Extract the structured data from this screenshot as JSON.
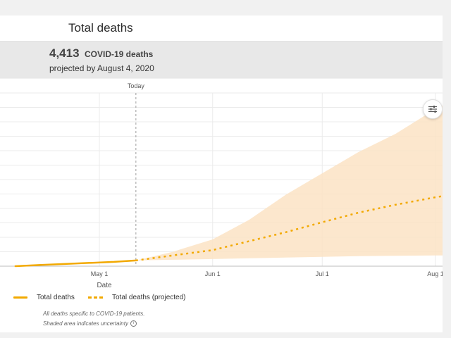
{
  "header": {
    "title": "Total deaths"
  },
  "summary": {
    "count": "4,413",
    "count_label": "COVID-19 deaths",
    "projection_text": "projected by August 4, 2020"
  },
  "chart_data": {
    "type": "line",
    "xlabel": "Date",
    "ylabel": "",
    "x_tick_labels": [
      "May 1",
      "Jun 1",
      "Jul 1",
      "Aug 1"
    ],
    "today_label": "Today",
    "grid": true,
    "legend_placement": "bottom",
    "series": [
      {
        "name": "Total deaths",
        "style": "solid",
        "color": "#f2a900",
        "x": [
          "Apr 8",
          "Apr 15",
          "Apr 22",
          "Apr 29",
          "May 5",
          "May 11"
        ],
        "y": [
          0.0,
          0.035,
          0.065,
          0.095,
          0.12,
          0.16
        ]
      },
      {
        "name": "Total deaths (projected)",
        "style": "dotted",
        "color": "#f2a900",
        "x": [
          "May 11",
          "May 21",
          "Jun 1",
          "Jun 11",
          "Jun 21",
          "Jul 1",
          "Jul 11",
          "Jul 21",
          "Aug 1",
          "Aug 4"
        ],
        "y": [
          0.16,
          0.3,
          0.45,
          0.7,
          0.95,
          1.23,
          1.5,
          1.72,
          1.93,
          1.98
        ]
      }
    ],
    "uncertainty": {
      "color": "#fbe3c4",
      "x": [
        "May 11",
        "May 21",
        "Jun 1",
        "Jun 11",
        "Jun 21",
        "Jul 1",
        "Jul 11",
        "Jul 21",
        "Aug 1",
        "Aug 4"
      ],
      "lower": [
        0.16,
        0.18,
        0.2,
        0.22,
        0.24,
        0.26,
        0.28,
        0.29,
        0.3,
        0.3
      ],
      "upper": [
        0.16,
        0.4,
        0.75,
        1.3,
        2.0,
        2.6,
        3.2,
        3.7,
        4.4,
        4.55
      ]
    },
    "ylim": [
      0,
      4.85
    ]
  },
  "legend": {
    "actual_label": "Total deaths",
    "projected_label": "Total deaths (projected)"
  },
  "notes": {
    "line1": "All deaths specific to COVID-19 patients.",
    "line2": "Shaded area indicates uncertainty"
  },
  "icons": {
    "settings": "sliders-icon",
    "info": "info-icon"
  }
}
